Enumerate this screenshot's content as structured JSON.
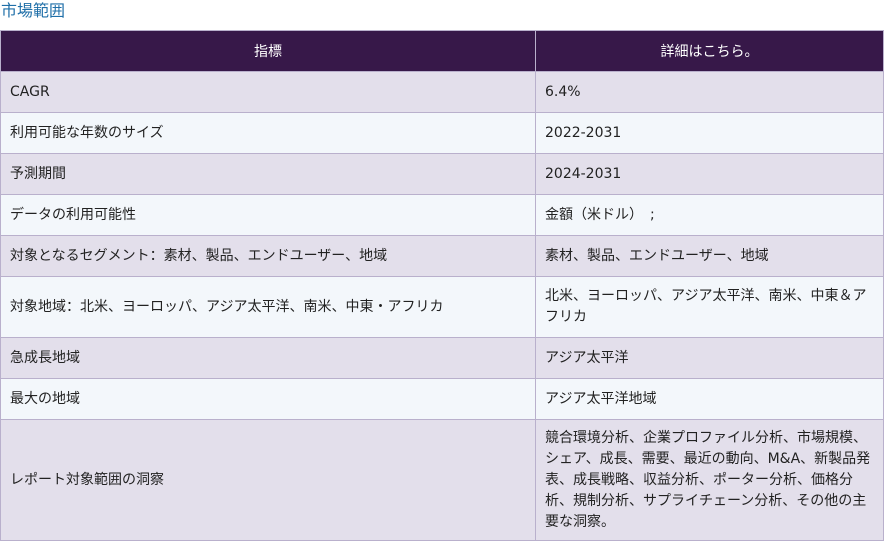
{
  "heading": "市場範囲",
  "table": {
    "headers": [
      "指標",
      "詳細はこちら。"
    ],
    "rows": [
      {
        "label": "CAGR",
        "value": "6.4%"
      },
      {
        "label": "利用可能な年数のサイズ",
        "value": "2022-2031"
      },
      {
        "label": "予測期間",
        "value": "2024-2031"
      },
      {
        "label": "データの利用可能性",
        "value": "金額（米ドル）　;"
      },
      {
        "label": "対象となるセグメント：素材、製品、エンドユーザー、地域",
        "value": "素材、製品、エンドユーザー、地域"
      },
      {
        "label": "対象地域：北米、ヨーロッパ、アジア太平洋、南米、中東・アフリカ",
        "value": "北米、ヨーロッパ、アジア太平洋、南米、中東＆アフリカ"
      },
      {
        "label": "急成長地域",
        "value": "アジア太平洋"
      },
      {
        "label": "最大の地域",
        "value": "アジア太平洋地域"
      },
      {
        "label": "レポート対象範囲の洞察",
        "value": "競合環境分析、企業プロファイル分析、市場規模、シェア、成長、需要、最近の動向、M&A、新製品発表、成長戦略、収益分析、ポーター分析、価格分析、規制分析、サプライチェーン分析、その他の主要な洞察。"
      }
    ]
  }
}
